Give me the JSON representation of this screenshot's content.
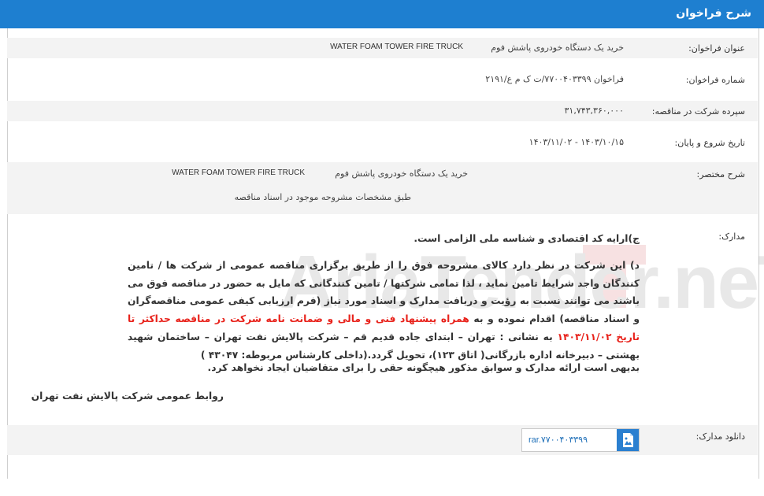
{
  "header": {
    "title": "شرح فراخوان"
  },
  "fields": {
    "title": {
      "label": "عنوان فراخوان:",
      "value_fa": "خرید یک دستگاه خودروی پاشش فوم",
      "value_en": "WATER FOAM TOWER FIRE TRUCK"
    },
    "number": {
      "label": "شماره فراخوان:",
      "value": "فراخوان ۷۷۰۰۴۰۳۳۹۹/ت ک م ع/۲۱۹۱"
    },
    "deposit": {
      "label": "سپرده شرکت در مناقصه:",
      "value": "۳۱,۷۴۳,۳۶۰,۰۰۰"
    },
    "dates": {
      "label": "تاریخ شروع و پایان:",
      "value": "۱۴۰۳/۱۰/۱۵ - ۱۴۰۳/۱۱/۰۲"
    },
    "summary": {
      "label": "شرح مختصر:",
      "line1_fa": "خرید یک دستگاه خودروی پاشش فوم",
      "line1_en": "WATER FOAM TOWER FIRE TRUCK",
      "line2": "طبق مشخصات مشروحه موجود در اسناد مناقصه"
    },
    "docs": {
      "label": "مدارک:",
      "item_c": "ج)ارایه کد اقتصادی و شناسه ملی الزامی است.",
      "para_d1": "د) این شرکت در نظر دارد کالای مشروحه فوق را از طریق برگزاری مناقصه عمومی از شرکت ها / تامین کنندگان واجد شرایط تامین نماید ، لذا تمامی شرکتها / تامین کنندگانی که مایل به حضور در مناقصه فوق می باشند می توانند نسبت به رؤیت و دریافت مدارک و اسناد مورد نیاز (فرم ارزیابی کیفی عمومی مناقصه‌گران و اسناد مناقصه) اقدام نموده و به ",
      "para_d_red": "همراه پیشنهاد فنی و مالی و ضمانت نامه شرکت در مناقصه حداکثر تا تاریخ ۱۴۰۳/۱۱/۰۲",
      "para_d2": " به نشانی : تهران – ابتدای جاده قدیم قم – شرکت پالایش نفت تهران – ساختمان شهید بهشتی – دبیرخانه اداره بازرگانی( اتاق ۱۲۳)، تحویل گردد.(داخلی کارشناس مربوطه: ۴۳۰۴۷ )",
      "note": "بدیهی است ارائه مدارک و سوابق مذکور هیچگونه حقی را برای متقاضیان ایجاد نخواهد کرد.",
      "signature": "روابط عمومی شرکت پالایش نفت تهران"
    },
    "download": {
      "label": "دانلود مدارک:",
      "file": "rar.۷۷۰۰۴۰۳۳۹۹"
    }
  },
  "watermark": {
    "text": "AriaTender.neT"
  },
  "colors": {
    "header_bg": "#1e7fd0",
    "accent_red": "#e8221b",
    "link": "#1e6fb8"
  }
}
